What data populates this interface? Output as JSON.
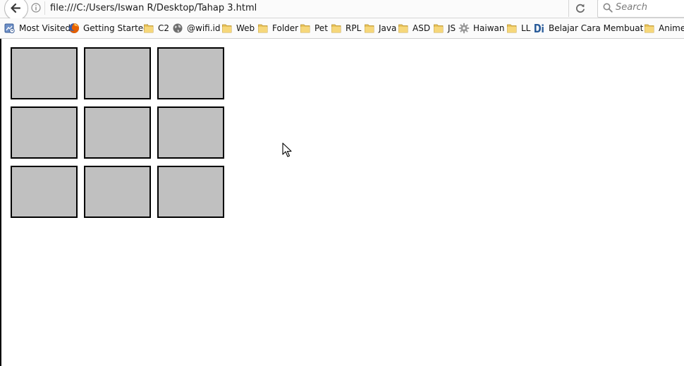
{
  "navbar": {
    "url": "file:///C:/Users/Iswan R/Desktop/Tahap 3.html",
    "search_placeholder": "Search"
  },
  "bookmarks": [
    {
      "label": "Most Visited",
      "icon": "most-visited-icon"
    },
    {
      "label": "Getting Started",
      "icon": "firefox-icon"
    },
    {
      "label": "C2",
      "icon": "folder-icon"
    },
    {
      "label": "@wifi.id",
      "icon": "globe-icon"
    },
    {
      "label": "Web",
      "icon": "folder-icon"
    },
    {
      "label": "Folder",
      "icon": "folder-icon"
    },
    {
      "label": "Pet",
      "icon": "folder-icon"
    },
    {
      "label": "RPL",
      "icon": "folder-icon"
    },
    {
      "label": "Java",
      "icon": "folder-icon"
    },
    {
      "label": "ASD",
      "icon": "folder-icon"
    },
    {
      "label": "JS",
      "icon": "folder-icon"
    },
    {
      "label": "Haiwan",
      "icon": "gear-icon"
    },
    {
      "label": "LL",
      "icon": "folder-icon"
    },
    {
      "label": "Belajar Cara Membuat ...",
      "icon": "site-di-icon"
    },
    {
      "label": "Anime",
      "icon": "folder-icon"
    }
  ],
  "grid": {
    "rows": 3,
    "cols": 3,
    "tile_color": "#c0c0c0",
    "border_color": "#000000"
  }
}
